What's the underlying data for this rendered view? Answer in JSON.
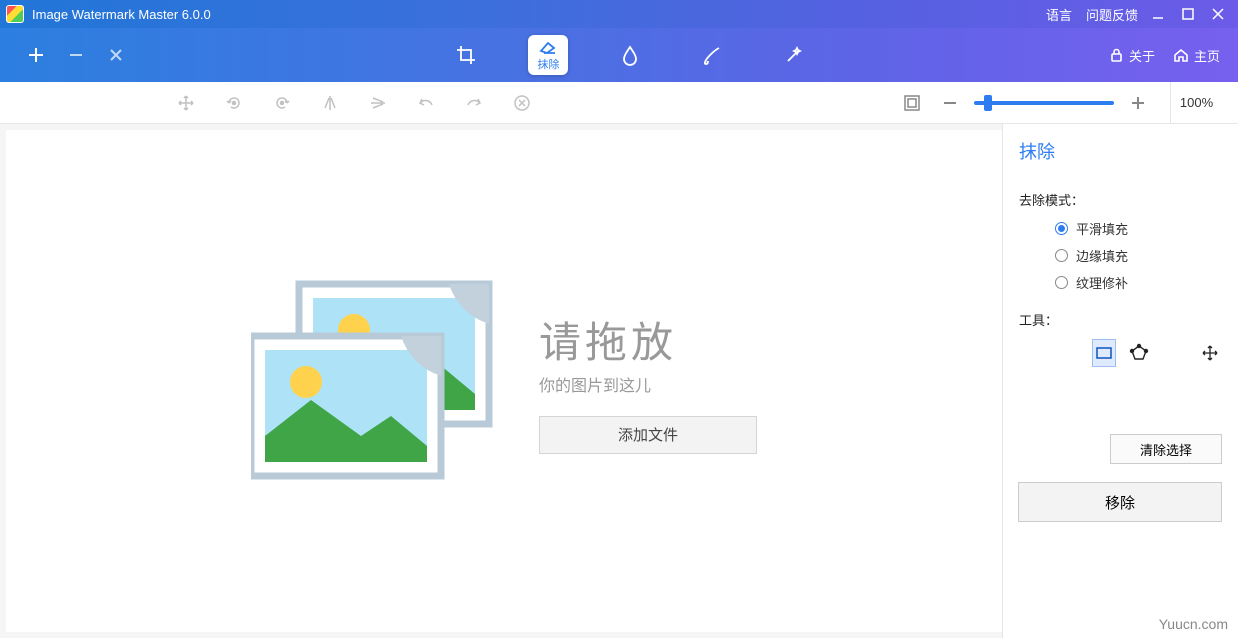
{
  "title": "Image Watermark Master 6.0.0",
  "titlebar": {
    "language": "语言",
    "feedback": "问题反馈"
  },
  "maintb": {
    "erase": "抹除",
    "about": "关于",
    "home": "主页"
  },
  "zoom": {
    "label": "100%"
  },
  "drop": {
    "big": "请拖放",
    "sm": "你的图片到这儿",
    "add": "添加文件"
  },
  "panel": {
    "title": "抹除",
    "modeLabel": "去除模式：",
    "m1": "平滑填充",
    "m2": "边缘填充",
    "m3": "纹理修补",
    "toolsLabel": "工具：",
    "clear": "清除选择",
    "remove": "移除"
  },
  "watermark": "Yuucn.com"
}
